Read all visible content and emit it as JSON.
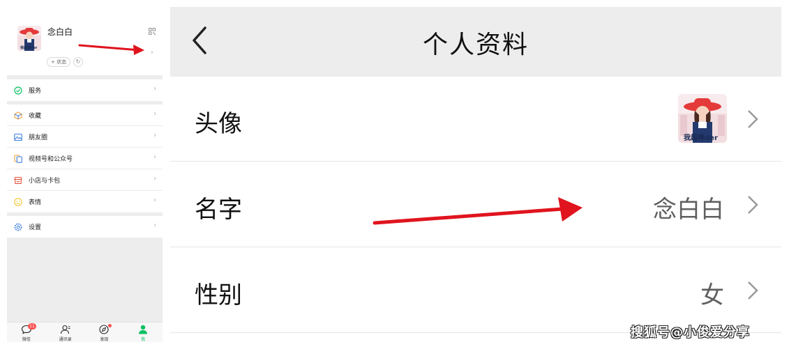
{
  "left_panel": {
    "profile": {
      "name": "念白白",
      "status_label": "+ 状态"
    },
    "group1": [
      {
        "label": "服务",
        "icon": "service-icon"
      }
    ],
    "group2": [
      {
        "label": "收藏",
        "icon": "favorites-icon"
      },
      {
        "label": "朋友圈",
        "icon": "moments-icon"
      },
      {
        "label": "视频号和公众号",
        "icon": "channels-icon"
      },
      {
        "label": "小店与卡包",
        "icon": "shop-icon"
      },
      {
        "label": "表情",
        "icon": "sticker-icon"
      }
    ],
    "group3": [
      {
        "label": "设置",
        "icon": "settings-icon"
      }
    ],
    "tabbar": {
      "tabs": [
        {
          "label": "微信",
          "badge": "11"
        },
        {
          "label": "通讯录"
        },
        {
          "label": "发现"
        },
        {
          "label": "我"
        }
      ]
    }
  },
  "right_panel": {
    "title": "个人资料",
    "rows": [
      {
        "label": "头像",
        "value": ""
      },
      {
        "label": "名字",
        "value": "念白白"
      },
      {
        "label": "性别",
        "value": "女"
      }
    ],
    "avatar_watermark": "我超棒der"
  },
  "watermark": "搜狐号@小俊爱分享",
  "colors": {
    "accent": "#07c160",
    "badge": "#fa5151",
    "arrow": "#e0141e",
    "header_bg": "#ededed"
  }
}
